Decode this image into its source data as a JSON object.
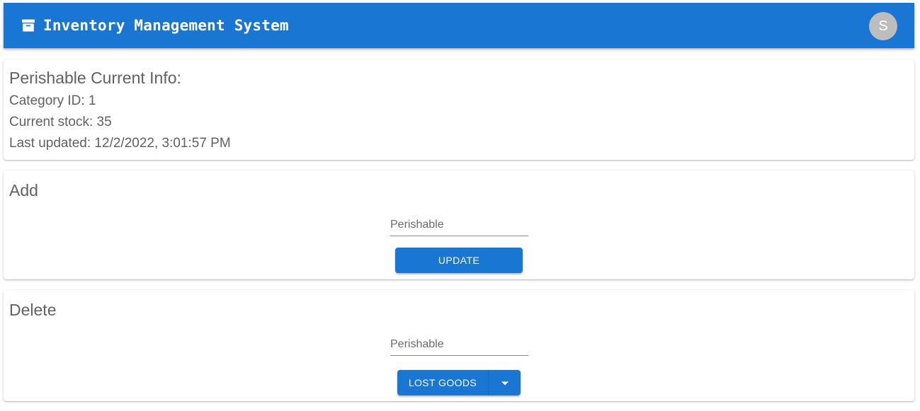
{
  "header": {
    "title": "Inventory Management System",
    "avatar_letter": "S",
    "icon": "archive-box-icon",
    "color": "#1976d2"
  },
  "info": {
    "title": "Perishable Current Info:",
    "category_line": "Category ID: 1",
    "stock_line": "Current stock: 35",
    "updated_line": "Last updated: 12/2/2022, 3:01:57 PM"
  },
  "add": {
    "title": "Add",
    "input_placeholder": "Perishable",
    "button_label": "UPDATE"
  },
  "delete": {
    "title": "Delete",
    "input_placeholder": "Perishable",
    "button_label": "LOST GOODS",
    "dropdown_icon": "caret-down-icon"
  }
}
